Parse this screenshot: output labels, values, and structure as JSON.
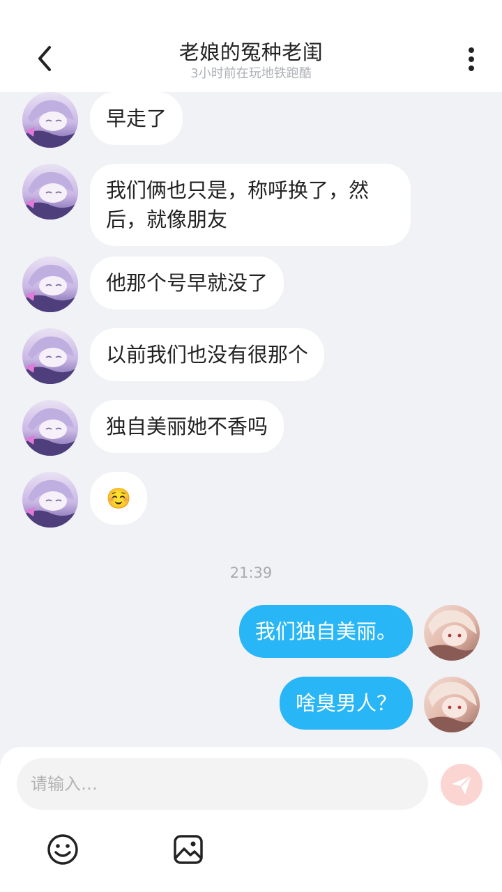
{
  "header": {
    "title": "老娘的冤种老闺",
    "subtitle": "3小时前在玩地铁跑酷"
  },
  "messages": [
    {
      "side": "in",
      "text": "早走了"
    },
    {
      "side": "in",
      "text": "我们俩也只是，称呼换了，然后，就像朋友"
    },
    {
      "side": "in",
      "text": "他那个号早就没了"
    },
    {
      "side": "in",
      "text": "以前我们也没有很那个"
    },
    {
      "side": "in",
      "text": "独自美丽她不香吗"
    },
    {
      "side": "in",
      "text": "☺️"
    },
    {
      "side": "out",
      "text": "我们独自美丽。"
    },
    {
      "side": "out",
      "text": "啥臭男人？"
    }
  ],
  "timestamp": "21:39",
  "input": {
    "placeholder": "请输入…"
  },
  "colors": {
    "outgoing_bubble": "#28b6f6",
    "incoming_bubble": "#ffffff",
    "background": "#f1f2f5",
    "send_button": "#fbd5d2"
  },
  "icons": {
    "back": "chevron-left-icon",
    "more": "more-vertical-icon",
    "send": "paper-plane-icon",
    "emoji": "smiley-icon",
    "image": "image-icon"
  }
}
